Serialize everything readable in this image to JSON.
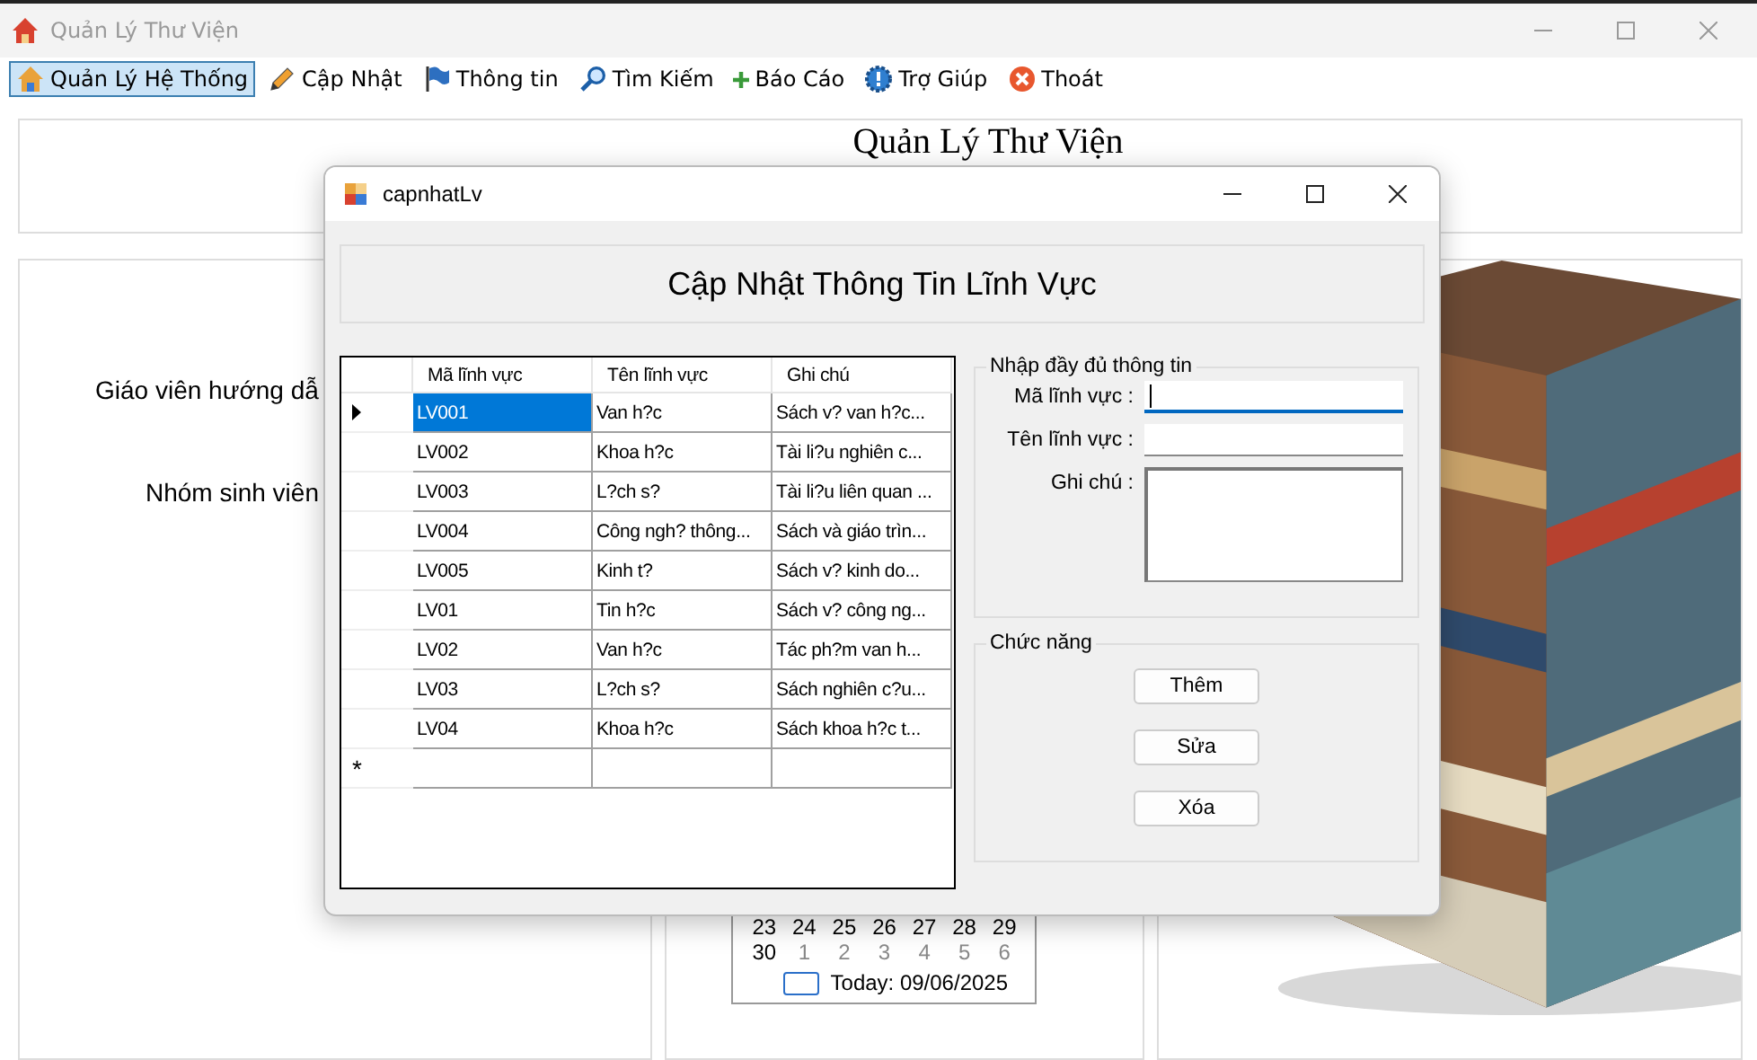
{
  "window": {
    "title": "Quản Lý Thư Viện"
  },
  "menu": [
    {
      "label": "Quản Lý Hệ Thống",
      "selected": true
    },
    {
      "label": "Cập Nhật",
      "selected": false
    },
    {
      "label": "Thông tin",
      "selected": false
    },
    {
      "label": "Tìm Kiếm",
      "selected": false
    },
    {
      "label": "Báo Cáo",
      "selected": false
    },
    {
      "label": "Trợ Giúp",
      "selected": false
    },
    {
      "label": "Thoát",
      "selected": false
    }
  ],
  "header": {
    "title": "Quản Lý Thư Viện"
  },
  "left_panel": {
    "labels": [
      "Giáo viên hướng dẫ",
      "Nhóm sinh viên"
    ]
  },
  "calendar": {
    "weeks": [
      [
        {
          "day": "23",
          "other_month": false
        },
        {
          "day": "24",
          "other_month": false
        },
        {
          "day": "25",
          "other_month": false
        },
        {
          "day": "26",
          "other_month": false
        },
        {
          "day": "27",
          "other_month": false
        },
        {
          "day": "28",
          "other_month": false
        },
        {
          "day": "29",
          "other_month": false
        }
      ],
      [
        {
          "day": "30",
          "other_month": false
        },
        {
          "day": "1",
          "other_month": true
        },
        {
          "day": "2",
          "other_month": true
        },
        {
          "day": "3",
          "other_month": true
        },
        {
          "day": "4",
          "other_month": true
        },
        {
          "day": "5",
          "other_month": true
        },
        {
          "day": "6",
          "other_month": true
        }
      ]
    ],
    "today": "Today: 09/06/2025"
  },
  "dialog": {
    "title": "capnhatLv",
    "heading": "Cập Nhật Thông Tin Lĩnh Vực",
    "table": {
      "columns": [
        "Mã lĩnh vực",
        "Tên lĩnh vực",
        "Ghi chú"
      ],
      "rows": [
        {
          "cells": [
            "LV001",
            "Van h?c",
            "Sách v? van h?c..."
          ],
          "selected": true
        },
        {
          "cells": [
            "LV002",
            "Khoa h?c",
            "Tài li?u nghiên c..."
          ],
          "selected": false
        },
        {
          "cells": [
            "LV003",
            "L?ch s?",
            "Tài li?u liên quan ..."
          ],
          "selected": false
        },
        {
          "cells": [
            "LV004",
            "Công ngh? thông...",
            "Sách và giáo trìn..."
          ],
          "selected": false
        },
        {
          "cells": [
            "LV005",
            "Kinh t?",
            "Sách v? kinh do..."
          ],
          "selected": false
        },
        {
          "cells": [
            "LV01",
            "Tin h?c",
            "Sách v? công ng..."
          ],
          "selected": false
        },
        {
          "cells": [
            "LV02",
            "Van h?c",
            "Tác ph?m van h..."
          ],
          "selected": false
        },
        {
          "cells": [
            "LV03",
            "L?ch s?",
            "Sách nghiên c?u..."
          ],
          "selected": false
        },
        {
          "cells": [
            "LV04",
            "Khoa h?c",
            "Sách khoa h?c t..."
          ],
          "selected": false
        }
      ],
      "new_row_mark": "*"
    },
    "input_group": {
      "title": "Nhập đầy đủ thông tin",
      "fields": [
        {
          "label": "Mã lĩnh vực :",
          "kind": "text",
          "focused": true
        },
        {
          "label": "Tên lĩnh vực :",
          "kind": "text",
          "focused": false
        },
        {
          "label": "Ghi chú :",
          "kind": "multiline",
          "focused": false
        }
      ]
    },
    "actions": {
      "title": "Chức năng",
      "buttons": [
        "Thêm",
        "Sửa",
        "Xóa"
      ]
    }
  }
}
